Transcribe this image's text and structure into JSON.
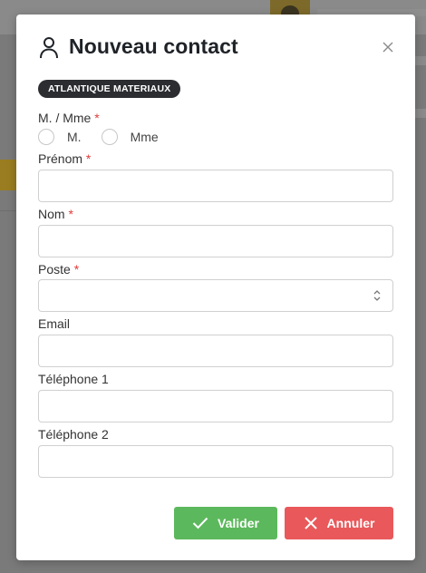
{
  "modal": {
    "title": "Nouveau contact",
    "company_badge": "ATLANTIQUE MATERIAUX",
    "required_mark": "*"
  },
  "fields": {
    "civility": {
      "label": "M. / Mme",
      "options": [
        "M.",
        "Mme"
      ]
    },
    "first_name": {
      "label": "Prénom",
      "value": ""
    },
    "last_name": {
      "label": "Nom",
      "value": ""
    },
    "position": {
      "label": "Poste",
      "value": ""
    },
    "email": {
      "label": "Email",
      "value": ""
    },
    "phone1": {
      "label": "Téléphone 1",
      "value": ""
    },
    "phone2": {
      "label": "Téléphone 2",
      "value": ""
    }
  },
  "actions": {
    "validate_label": "Valider",
    "cancel_label": "Annuler"
  },
  "colors": {
    "validate": "#5cb85c",
    "cancel": "#e9585a",
    "badge": "#2b2d31",
    "required": "#e03b3b"
  },
  "icons": {
    "header": "user-icon",
    "close": "close-icon",
    "validate": "check-icon",
    "cancel": "x-icon",
    "select": "chevron-updown-icon"
  }
}
